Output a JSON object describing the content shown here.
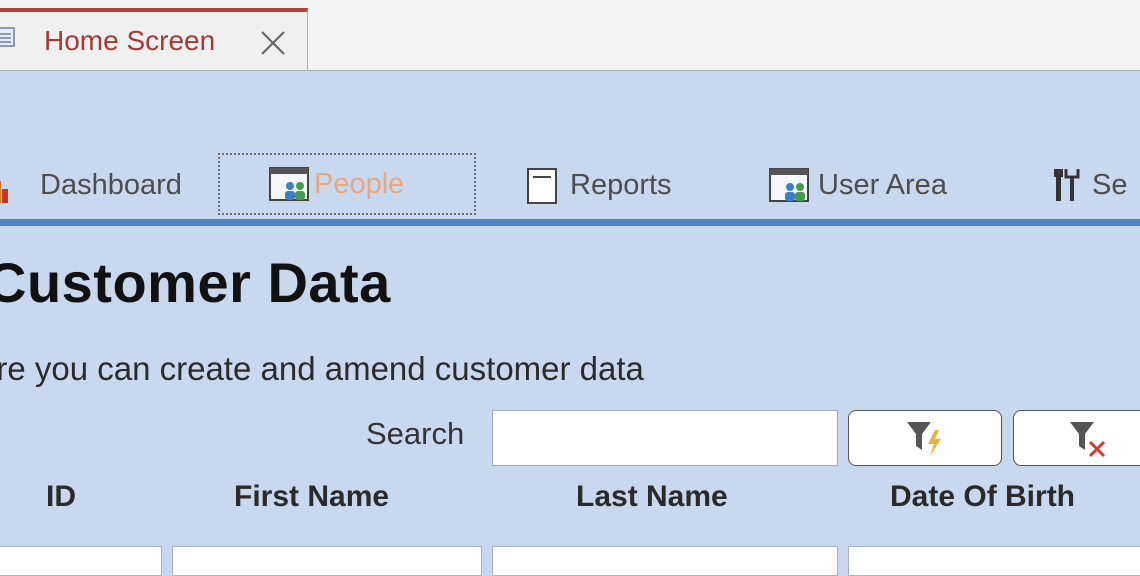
{
  "tab": {
    "label": "Home Screen"
  },
  "nav": {
    "items": [
      {
        "label": "Dashboard",
        "icon": "bar-chart-icon"
      },
      {
        "label": "People",
        "icon": "people-form-icon",
        "selected": true
      },
      {
        "label": "Reports",
        "icon": "report-icon"
      },
      {
        "label": "User Area",
        "icon": "people-form-icon"
      },
      {
        "label": "Se",
        "icon": "tools-icon"
      }
    ]
  },
  "page": {
    "title": "Customer Data",
    "subtitle": "ere you can create and amend customer data"
  },
  "search": {
    "label": "Search",
    "value": "",
    "apply_filter_icon": "filter-lightning-icon",
    "clear_filter_icon": "filter-clear-icon"
  },
  "table": {
    "columns": [
      "ID",
      "First Name",
      "Last Name",
      "Date Of Birth"
    ]
  },
  "colors": {
    "background": "#c8d9ef",
    "divider": "#4f82c5",
    "tab_accent": "#b3403a",
    "selected_nav": "#e9a77f"
  }
}
